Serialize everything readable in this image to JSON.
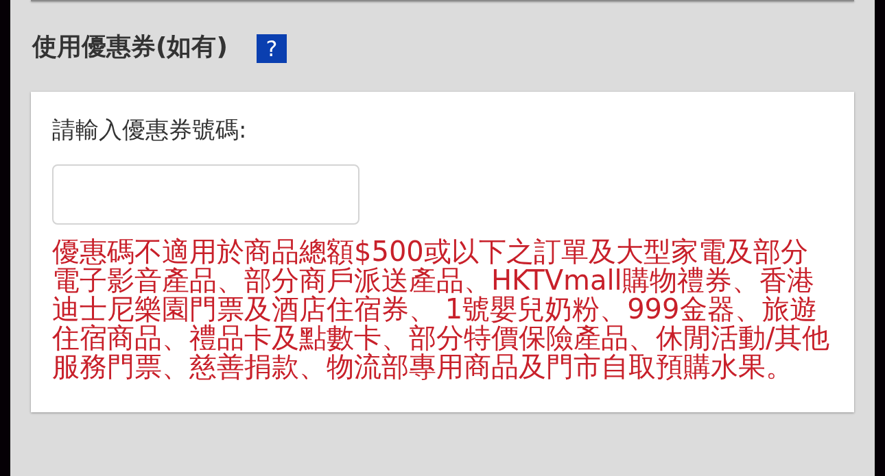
{
  "section": {
    "title": "使用優惠券(如有)",
    "help_button": "?"
  },
  "coupon_card": {
    "label": "請輸入優惠券號碼:",
    "notice": "優惠碼不適用於商品總額$500或以下之訂單及大型家電及部分電子影音產品、部分商戶派送產品、HKTVmall購物禮券、香港迪士尼樂園門票及酒店住宿券、 1號嬰兒奶粉、999金器、旅遊住宿商品、禮品卡及點數卡、部分特價保險產品、休閒活動/其他服務門票、慈善捐款、物流部專用商品及門市自取預購水果。"
  }
}
